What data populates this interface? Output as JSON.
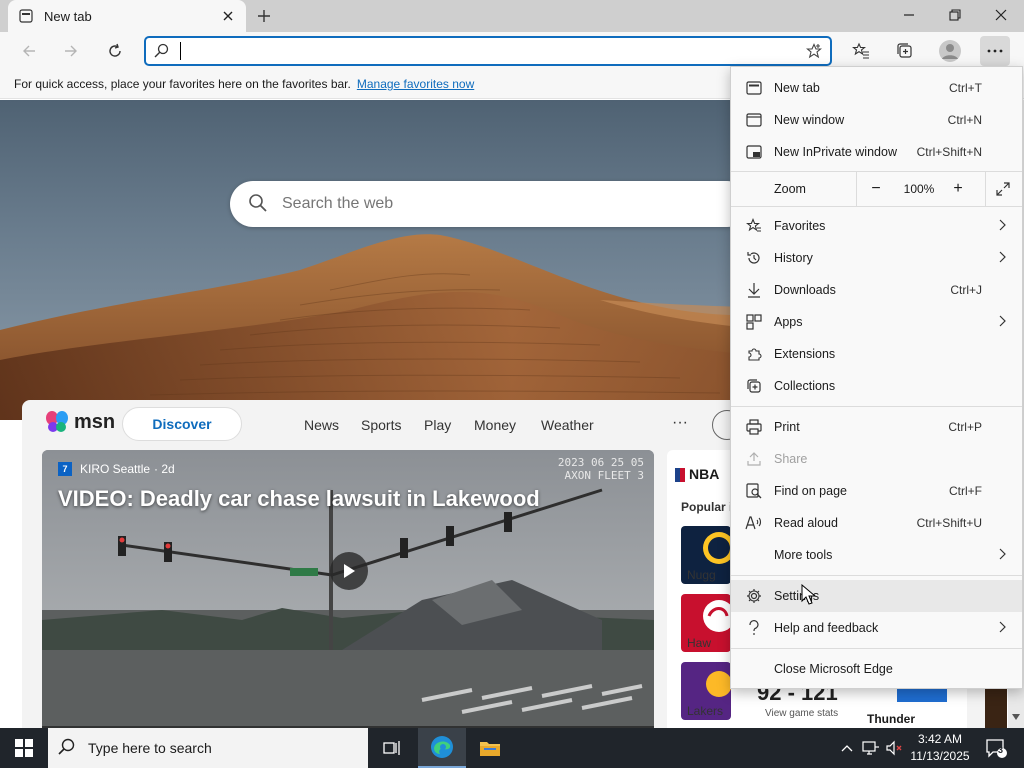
{
  "browser": {
    "tab": {
      "title": "New tab",
      "icon": "tab-page-icon"
    },
    "new_tab_icon": "plus-icon",
    "window_controls": [
      "minimize-icon",
      "restore-icon",
      "close-icon"
    ],
    "address_bar": {
      "value": "",
      "placeholder": ""
    },
    "favorites_bar": {
      "message": "For quick access, place your favorites here on the favorites bar.",
      "link": "Manage favorites now"
    }
  },
  "newtab": {
    "search_placeholder": "Search the web",
    "msn": {
      "logo_text": "msn",
      "discover": "Discover",
      "nav": [
        "News",
        "Sports",
        "Play",
        "Money",
        "Weather"
      ],
      "more": "···",
      "hero": {
        "source": "KIRO Seattle",
        "age": "· 2d",
        "title": "VIDEO: Deadly car chase lawsuit in Lakewood",
        "stamp_line1": "2023 06 25 05",
        "stamp_line2": "AXON FLEET 3"
      },
      "nba": {
        "title": "NBA",
        "popular": "Popular i",
        "teams": [
          "Nugg",
          "Haw",
          "Lakers"
        ],
        "score": "92 - 121",
        "score_sub": "View game stats",
        "right_team": "Thunder"
      }
    }
  },
  "menu": {
    "items": [
      {
        "label": "New tab",
        "shortcut": "Ctrl+T",
        "icon": "new-tab-icon"
      },
      {
        "label": "New window",
        "shortcut": "Ctrl+N",
        "icon": "new-window-icon"
      },
      {
        "label": "New InPrivate window",
        "shortcut": "Ctrl+Shift+N",
        "icon": "inprivate-icon"
      },
      {
        "label": "Favorites",
        "shortcut": "",
        "icon": "favorites-icon"
      },
      {
        "label": "History",
        "shortcut": "",
        "icon": "history-icon"
      },
      {
        "label": "Downloads",
        "shortcut": "Ctrl+J",
        "icon": "download-icon"
      },
      {
        "label": "Apps",
        "shortcut": "",
        "icon": "apps-icon"
      },
      {
        "label": "Extensions",
        "shortcut": "",
        "icon": "extensions-icon"
      },
      {
        "label": "Collections",
        "shortcut": "",
        "icon": "collections-icon"
      },
      {
        "label": "Print",
        "shortcut": "Ctrl+P",
        "icon": "print-icon"
      },
      {
        "label": "Share",
        "shortcut": "",
        "icon": "share-icon"
      },
      {
        "label": "Find on page",
        "shortcut": "Ctrl+F",
        "icon": "find-icon"
      },
      {
        "label": "Read aloud",
        "shortcut": "Ctrl+Shift+U",
        "icon": "read-aloud-icon"
      },
      {
        "label": "More tools",
        "shortcut": "",
        "icon": ""
      },
      {
        "label": "Settings",
        "shortcut": "",
        "icon": "gear-icon"
      },
      {
        "label": "Help and feedback",
        "shortcut": "",
        "icon": "help-icon"
      },
      {
        "label": "Close Microsoft Edge",
        "shortcut": "",
        "icon": ""
      }
    ],
    "zoom": {
      "label": "Zoom",
      "value": "100%",
      "minus": "−",
      "plus": "+"
    }
  },
  "taskbar": {
    "search_placeholder": "Type here to search",
    "time": "3:42 AM",
    "date": "11/13/2025",
    "notification_count": "3"
  },
  "colors": {
    "accent": "#0f6cbd",
    "taskbar": "#20252b",
    "menu_bg": "#f9f9f9"
  }
}
